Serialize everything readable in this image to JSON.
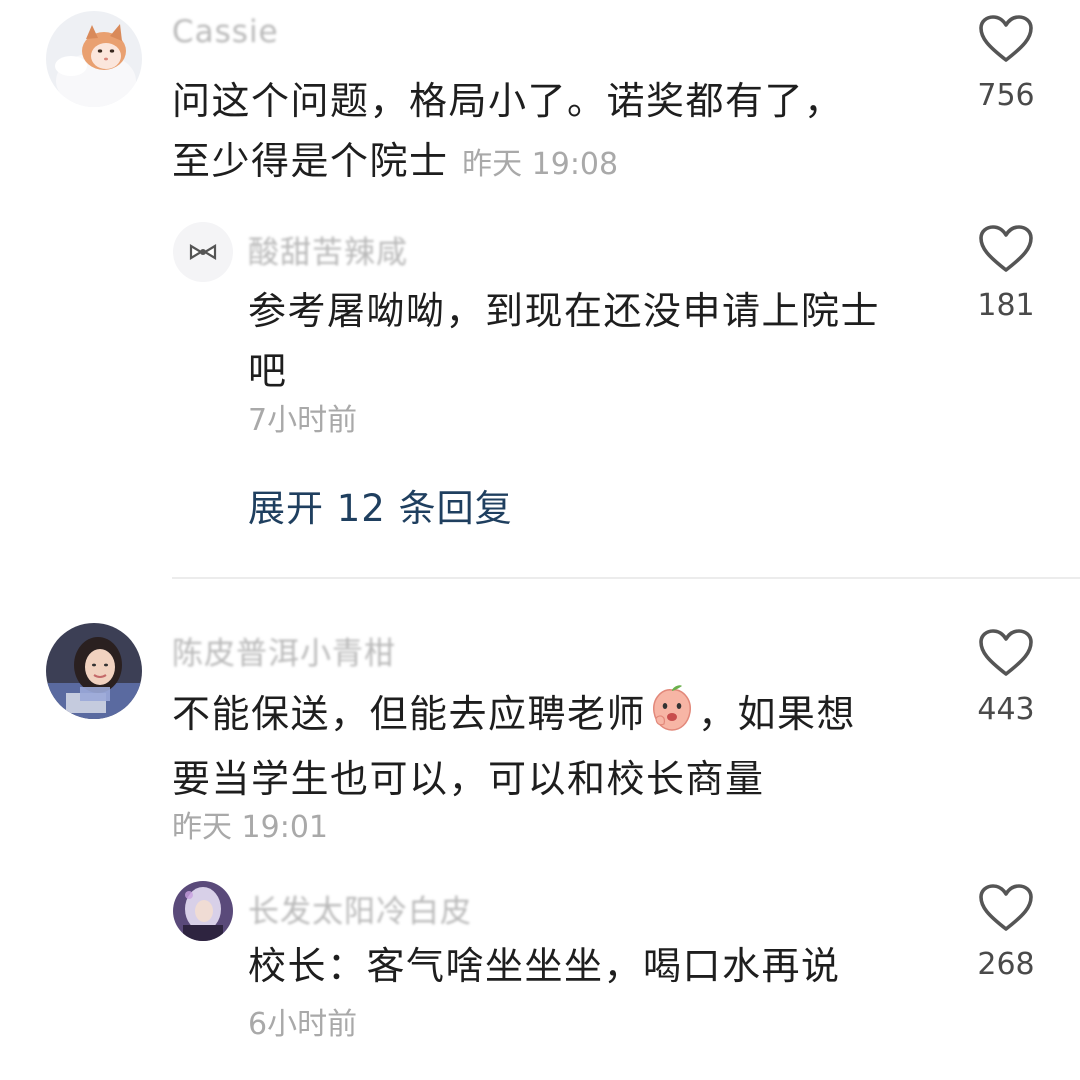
{
  "comments": [
    {
      "username": "Cassie",
      "text_lines": [
        "问这个问题，格局小了。诺奖都有了，",
        "至少得是个院士"
      ],
      "time": "昨天 19:08",
      "likes": "756",
      "replies": [
        {
          "username": "酸甜苦辣咸",
          "text_lines": [
            "参考屠呦呦，到现在还没申请上院士",
            "吧"
          ],
          "time": "7小时前",
          "likes": "181"
        }
      ],
      "expand_label": "展开 12 条回复"
    },
    {
      "username": "陈皮普洱小青柑",
      "text_before_emoji": "不能保送，但能去应聘老师",
      "text_after_emoji": "，如果想",
      "text_line2": "要当学生也可以，可以和校长商量",
      "time": "昨天 19:01",
      "likes": "443",
      "replies": [
        {
          "username": "长发太阳冷白皮",
          "text_lines": [
            "校长：客气啥坐坐坐，喝口水再说"
          ],
          "time": "6小时前",
          "likes": "268"
        }
      ]
    }
  ],
  "icons": {
    "like": "heart-outline-icon",
    "emoji": "peach-emoji-icon"
  },
  "colors": {
    "text": "#1e1e1e",
    "muted": "#a9a9a9",
    "username": "#b9b9b9",
    "expand": "#1f3f5f",
    "heart": "#555555"
  }
}
